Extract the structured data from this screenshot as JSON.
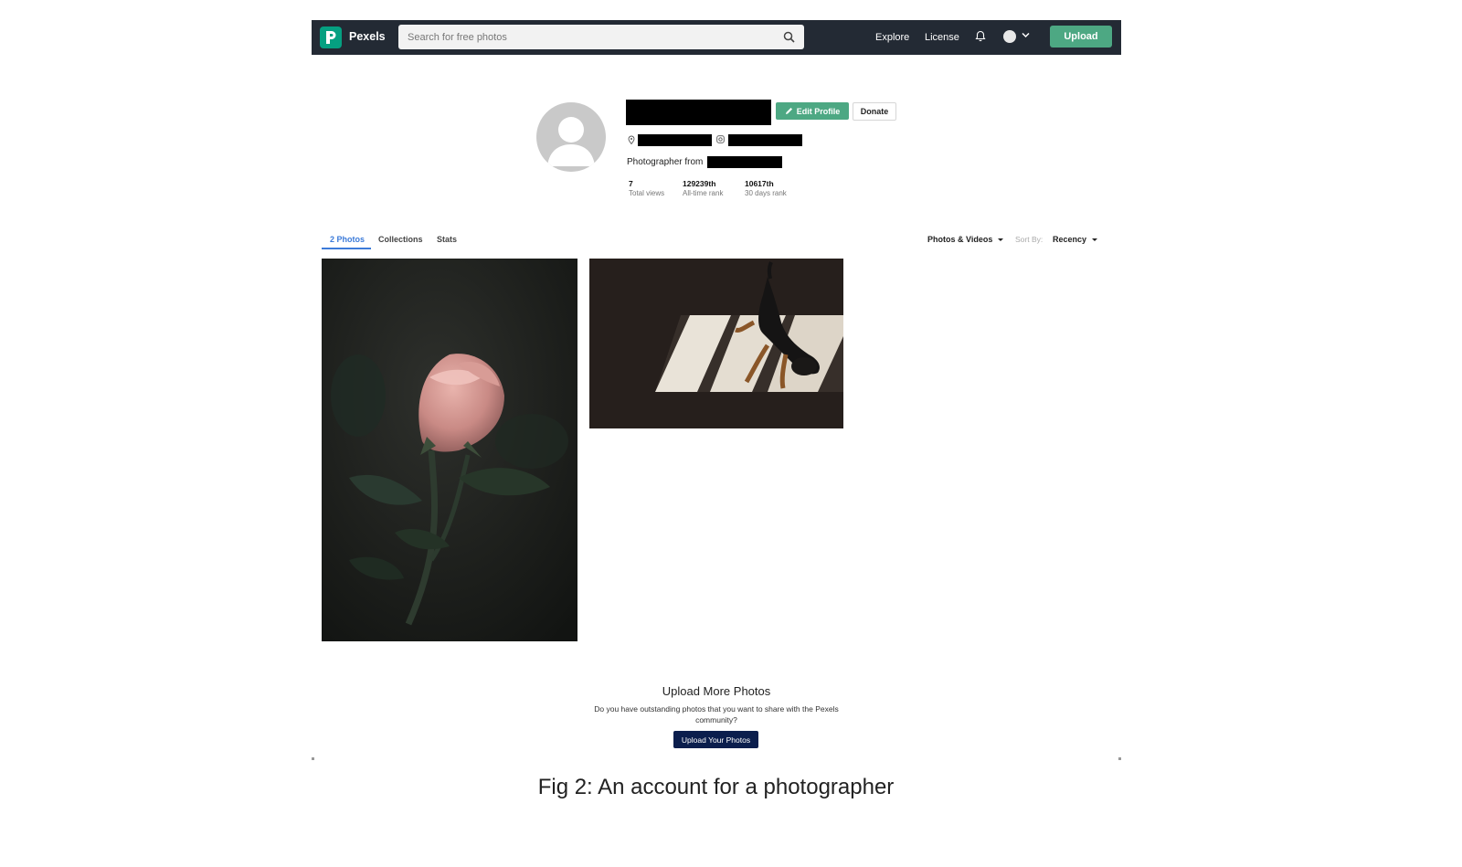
{
  "nav": {
    "brand": "Pexels",
    "search_placeholder": "Search for free photos",
    "links": [
      "Explore",
      "License"
    ],
    "upload_label": "Upload"
  },
  "profile": {
    "edit_label": "Edit Profile",
    "donate_label": "Donate",
    "bio_prefix": "Photographer from",
    "stats": [
      {
        "value": "7",
        "label": "Total views"
      },
      {
        "value": "129239th",
        "label": "All-time rank"
      },
      {
        "value": "10617th",
        "label": "30 days rank"
      }
    ]
  },
  "tabs": [
    "2 Photos",
    "Collections",
    "Stats"
  ],
  "filters": {
    "media_type": "Photos & Videos",
    "sort_by_label": "Sort By:",
    "sort_by_value": "Recency"
  },
  "upload_more": {
    "title": "Upload More Photos",
    "description": "Do you have outstanding photos that you want to share with the Pexels community?",
    "button": "Upload Your Photos"
  },
  "caption": "Fig 2: An account for a photographer",
  "colors": {
    "nav_bg": "#232a34",
    "brand_green": "#4da883",
    "active_tab": "#3c7bd9",
    "cta_navy": "#0b1e4d"
  }
}
